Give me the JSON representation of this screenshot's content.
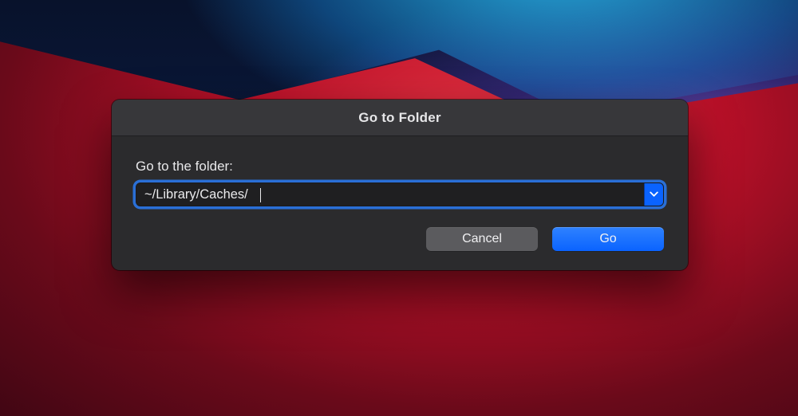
{
  "dialog": {
    "title": "Go to Folder",
    "label": "Go to the folder:",
    "path_value": "~/Library/Caches/",
    "buttons": {
      "cancel": "Cancel",
      "go": "Go"
    },
    "icons": {
      "disclosure": "chevron-down-icon"
    },
    "colors": {
      "accent": "#0a63ff",
      "focus_ring": "#2a6fd6",
      "sheet_bg": "#2b2b2d",
      "titlebar_bg": "#37373a"
    }
  }
}
